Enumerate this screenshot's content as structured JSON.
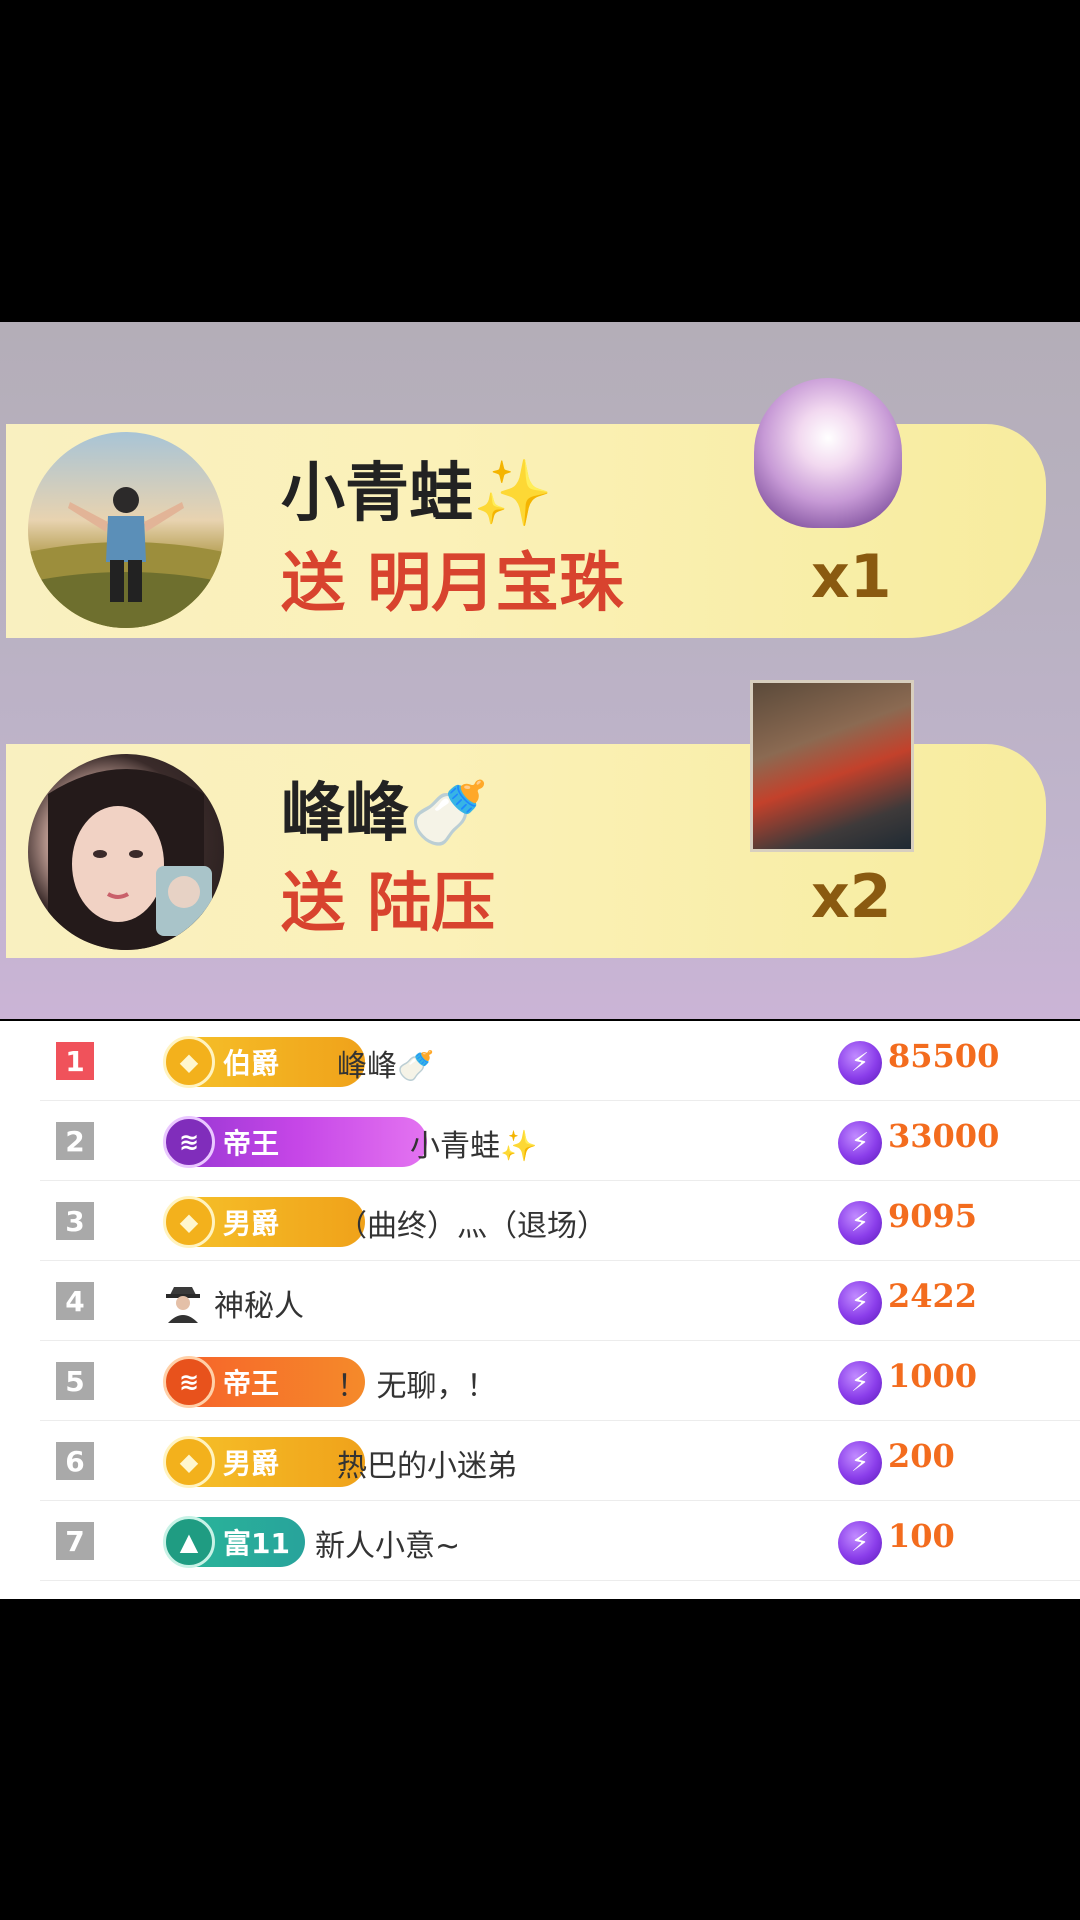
{
  "gifts": [
    {
      "sender": "小青蛙✨",
      "message": "送 明月宝珠",
      "count": "x1",
      "gift_icon": "pearl-lotus-icon"
    },
    {
      "sender": "峰峰🍼",
      "message": "送 陆压",
      "count": "x2",
      "gift_icon": "lu-ya-card-image"
    }
  ],
  "leaderboard": [
    {
      "rank": "1",
      "badge": "伯爵",
      "badge_style": "gold",
      "name": "峰峰🍼",
      "score": "85500"
    },
    {
      "rank": "2",
      "badge": "帝王",
      "badge_style": "purple",
      "name": "小青蛙✨",
      "score": "33000"
    },
    {
      "rank": "3",
      "badge": "男爵",
      "badge_style": "gold",
      "name": "（曲终）灬（退场）",
      "score": "9095"
    },
    {
      "rank": "4",
      "badge": "",
      "badge_style": "mystery",
      "name": "神秘人",
      "score": "2422"
    },
    {
      "rank": "5",
      "badge": "帝王",
      "badge_style": "orange",
      "name": "！ 无聊，！",
      "score": "1000"
    },
    {
      "rank": "6",
      "badge": "男爵",
      "badge_style": "gold",
      "name": "热巴的小迷弟",
      "score": "200"
    },
    {
      "rank": "7",
      "badge": "富11",
      "badge_style": "teal",
      "name": "新人小意~",
      "score": "100"
    }
  ],
  "colors": {
    "gift_text": "#d8432e",
    "score": "#f36c1e",
    "rank_first": "#f0525b",
    "rank_other": "#a9a9a9"
  }
}
